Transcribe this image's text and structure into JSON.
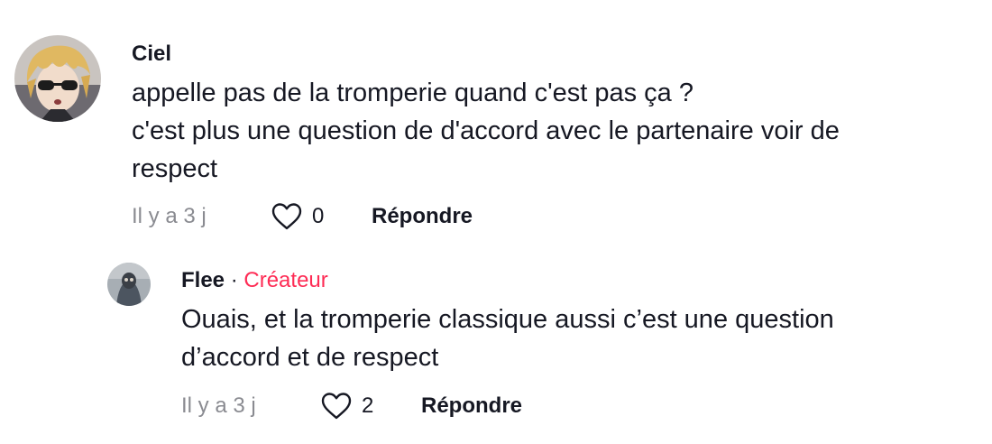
{
  "comments": [
    {
      "author": "Ciel",
      "text_lines": [
        "appelle pas de la tromperie quand c'est pas ça ?",
        "c'est plus une question de d'accord avec le partenaire voir de",
        "respect"
      ],
      "time": "Il y a 3 j",
      "likes": "0",
      "reply_label": "Répondre",
      "like_icon": "heart-outline-icon"
    }
  ],
  "replies": [
    {
      "author": "Flee",
      "separator": "·",
      "badge": "Créateur",
      "badge_color": "#fe2c55",
      "text_lines": [
        "Ouais, et la tromperie classique aussi c’est une question",
        "d’accord et de respect"
      ],
      "time": "Il y a 3 j",
      "likes": "2",
      "reply_label": "Répondre",
      "like_icon": "heart-outline-icon"
    }
  ]
}
